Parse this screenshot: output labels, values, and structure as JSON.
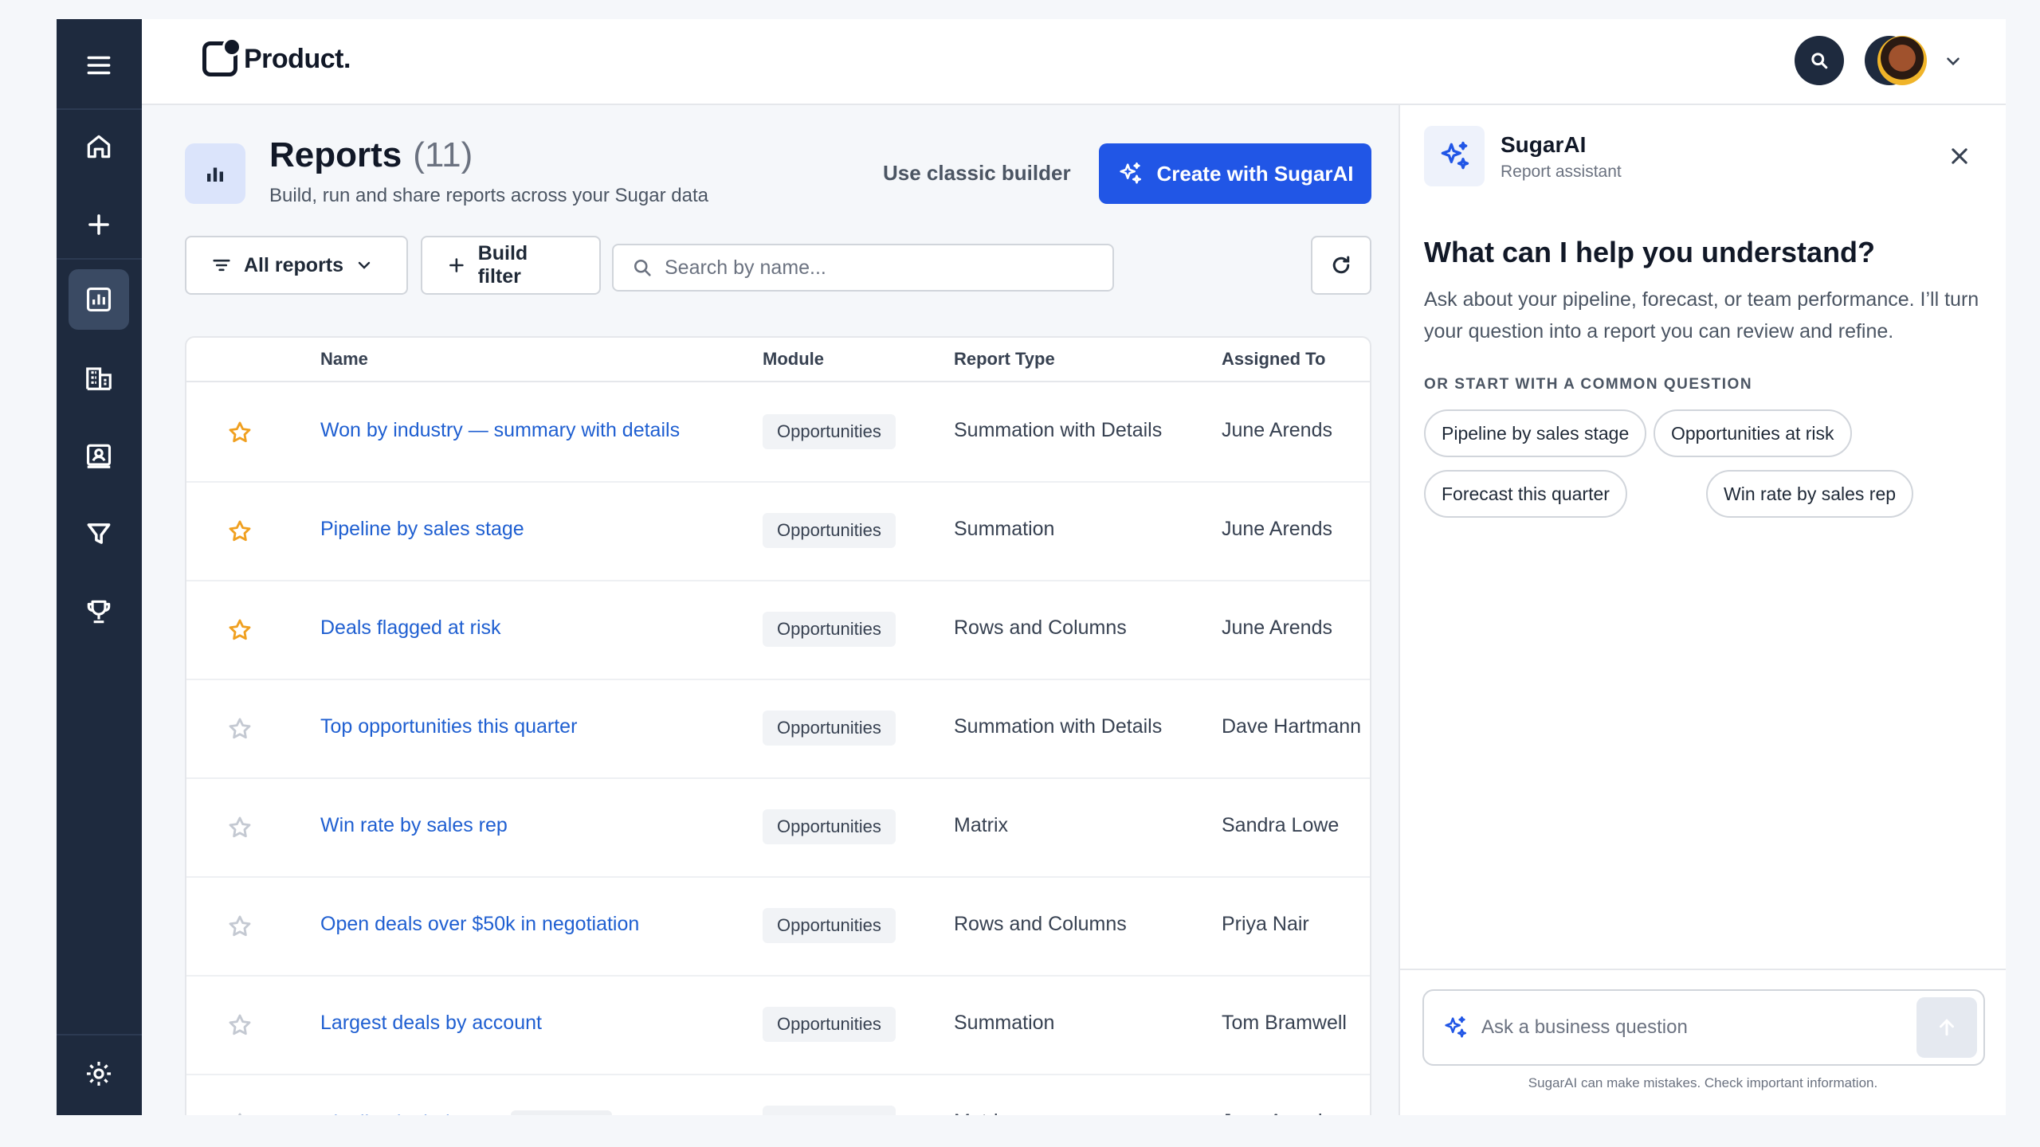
{
  "header": {
    "logo_text": "Product.",
    "search_icon": "search-icon",
    "bell_icon": "bell-icon",
    "avatar": "user-avatar"
  },
  "sidebar": {
    "items": [
      {
        "name": "menu",
        "icon": "hamburger-icon"
      },
      {
        "name": "home",
        "icon": "home-icon"
      },
      {
        "name": "create",
        "icon": "plus-icon"
      },
      {
        "name": "reports",
        "icon": "bar-chart-icon",
        "active": true
      },
      {
        "name": "accounts",
        "icon": "building-icon"
      },
      {
        "name": "contacts",
        "icon": "contact-card-icon"
      },
      {
        "name": "filters",
        "icon": "funnel-icon"
      },
      {
        "name": "achievements",
        "icon": "trophy-icon"
      },
      {
        "name": "settings",
        "icon": "gear-icon"
      }
    ]
  },
  "page": {
    "title": "Reports",
    "count": "(11)",
    "subtitle": "Build, run and share reports across your Sugar data",
    "classic_builder": "Use classic builder",
    "create_button": "Create with SugarAI"
  },
  "toolbar": {
    "all_reports": "All reports",
    "build_filter": "Build filter",
    "search_placeholder": "Search by name..."
  },
  "table": {
    "columns": [
      "Name",
      "Module",
      "Report Type",
      "Assigned To"
    ],
    "rows": [
      {
        "name": "Won by industry — summary with details",
        "module": "Opportunities",
        "type": "Summation with Details",
        "assigned": "June Arends",
        "starred": true
      },
      {
        "name": "Pipeline by sales stage",
        "module": "Opportunities",
        "type": "Summation",
        "assigned": "June Arends",
        "starred": true
      },
      {
        "name": "Deals flagged at risk",
        "module": "Opportunities",
        "type": "Rows and Columns",
        "assigned": "June Arends",
        "starred": true
      },
      {
        "name": "Top opportunities this quarter",
        "module": "Opportunities",
        "type": "Summation with Details",
        "assigned": "Dave Hartmann",
        "starred": false
      },
      {
        "name": "Win rate by sales rep",
        "module": "Opportunities",
        "type": "Matrix",
        "assigned": "Sandra Lowe",
        "starred": false
      },
      {
        "name": "Open deals over $50k in negotiation",
        "module": "Opportunities",
        "type": "Rows and Columns",
        "assigned": "Priya Nair",
        "starred": false
      },
      {
        "name": "Largest deals by account",
        "module": "Opportunities",
        "type": "Summation",
        "assigned": "Tom Bramwell",
        "starred": false
      },
      {
        "name": "Pipeline by industry",
        "badge": "Template",
        "module": "Opportunities",
        "type": "Matrix",
        "assigned": "June Arends",
        "starred": false
      }
    ]
  },
  "ai_panel": {
    "name": "SugarAI",
    "subtitle": "Report assistant",
    "heading": "What can I help you understand?",
    "description": "Ask about your pipeline, forecast, or team performance. I’ll turn your question into a report you can review and refine.",
    "suggestions_label": "OR START WITH A COMMON QUESTION",
    "suggestions": [
      "Pipeline by sales stage",
      "Opportunities at risk",
      "Forecast this quarter",
      "Win rate by sales rep"
    ],
    "input_placeholder": "Ask a business question",
    "disclaimer": "SugarAI can make mistakes. Check important information."
  },
  "colors": {
    "sidebar": "#1e2a3e",
    "accent": "#2156e6",
    "link": "#1f5fd1",
    "star": "#f0a020"
  }
}
